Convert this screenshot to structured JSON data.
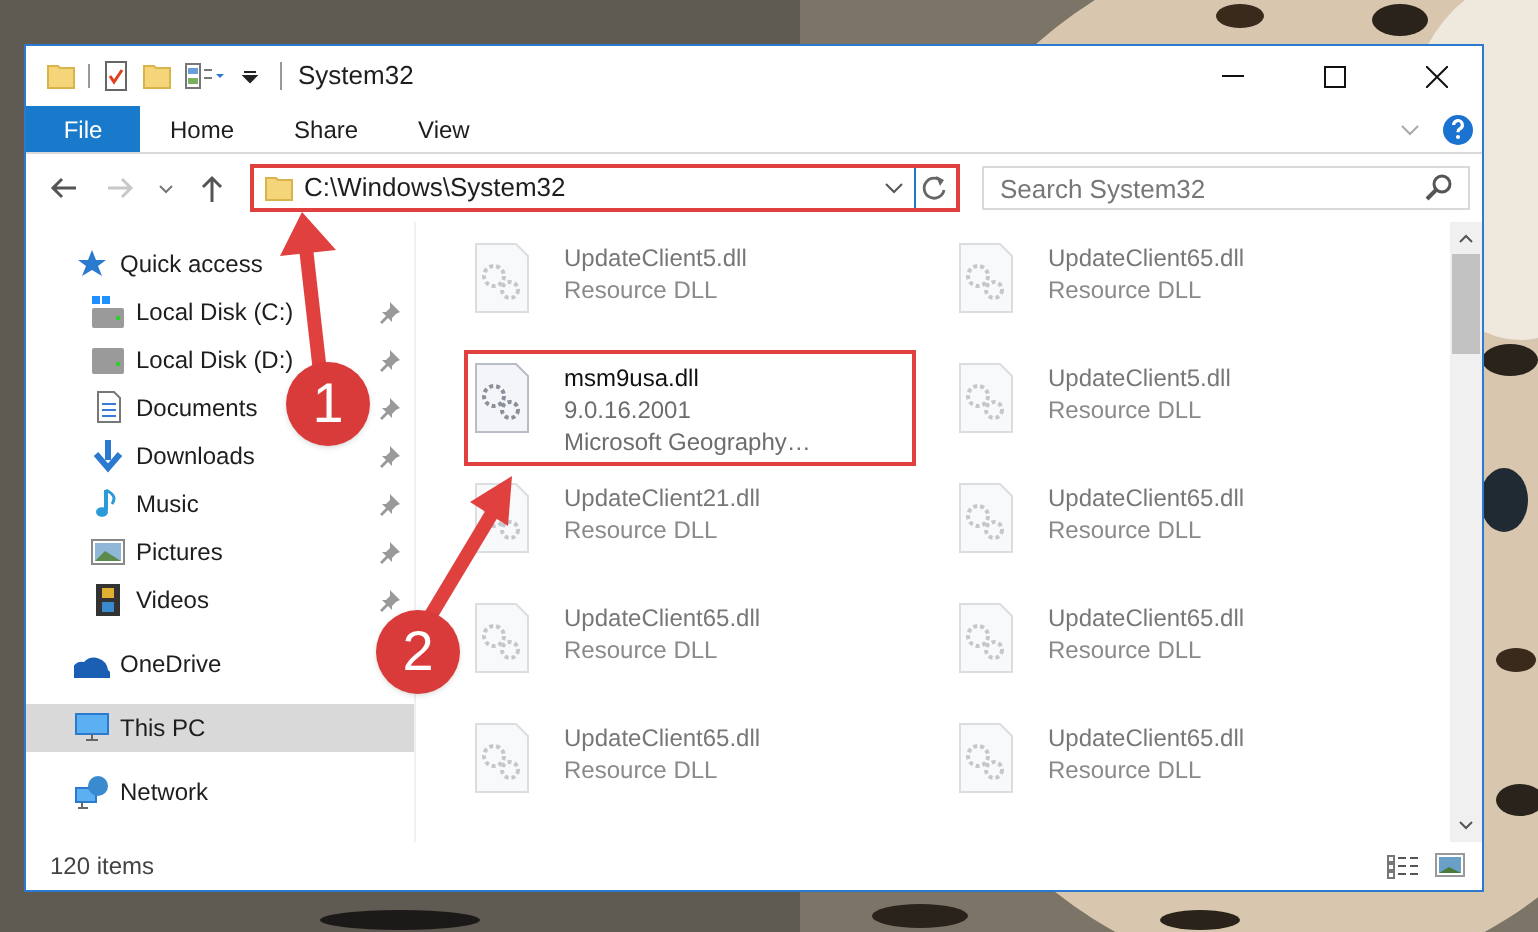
{
  "window": {
    "title": "System32"
  },
  "ribbon": {
    "tabs": [
      {
        "label": "File",
        "kind": "file"
      },
      {
        "label": "Home",
        "kind": "tab"
      },
      {
        "label": "Share",
        "kind": "tab"
      },
      {
        "label": "View",
        "kind": "tab"
      }
    ]
  },
  "navigation": {
    "back": {
      "disabled": false
    },
    "forward": {
      "disabled": true
    }
  },
  "address_bar": {
    "value": "C:\\Windows\\System32",
    "highlighted": true
  },
  "search": {
    "placeholder": "Search System32"
  },
  "sidebar": {
    "items": [
      {
        "label": "Quick access",
        "kind": "star",
        "selected": false,
        "children": [
          {
            "label": "Local Disk (C:)",
            "kind": "system-drive",
            "pinned": true
          },
          {
            "label": "Local Disk (D:)",
            "kind": "drive",
            "pinned": true
          },
          {
            "label": "Documents",
            "kind": "documents",
            "pinned": true
          },
          {
            "label": "Downloads",
            "kind": "downloads",
            "pinned": true
          },
          {
            "label": "Music",
            "kind": "music",
            "pinned": true
          },
          {
            "label": "Pictures",
            "kind": "pictures",
            "pinned": true
          },
          {
            "label": "Videos",
            "kind": "videos",
            "pinned": true
          }
        ]
      },
      {
        "label": "OneDrive",
        "kind": "cloud",
        "selected": false
      },
      {
        "label": "This PC",
        "kind": "computer",
        "selected": true
      },
      {
        "label": "Network",
        "kind": "network",
        "selected": false
      }
    ]
  },
  "files": [
    {
      "lines": [
        "UpdateClient5.dll",
        "Resource DLL"
      ],
      "blurred": true,
      "highlighted": false
    },
    {
      "lines": [
        "UpdateClient65.dll",
        "Resource DLL"
      ],
      "blurred": true,
      "highlighted": false
    },
    {
      "lines": [
        "msm9usa.dll",
        "9.0.16.2001",
        "Microsoft Geography…"
      ],
      "blurred": false,
      "highlighted": true
    },
    {
      "lines": [
        "UpdateClient5.dll",
        "Resource DLL"
      ],
      "blurred": true,
      "highlighted": false
    },
    {
      "lines": [
        "UpdateClient21.dll",
        "Resource DLL"
      ],
      "blurred": true,
      "highlighted": false
    },
    {
      "lines": [
        "UpdateClient65.dll",
        "Resource DLL"
      ],
      "blurred": true,
      "highlighted": false
    },
    {
      "lines": [
        "UpdateClient65.dll",
        "Resource DLL"
      ],
      "blurred": true,
      "highlighted": false
    },
    {
      "lines": [
        "UpdateClient65.dll",
        "Resource DLL"
      ],
      "blurred": true,
      "highlighted": false
    },
    {
      "lines": [
        "UpdateClient65.dll",
        "Resource DLL"
      ],
      "blurred": true,
      "highlighted": false
    },
    {
      "lines": [
        "UpdateClient65.dll",
        "Resource DLL"
      ],
      "blurred": true,
      "highlighted": false
    }
  ],
  "status_bar": {
    "text": "120 items"
  },
  "callouts": [
    {
      "label": "1"
    },
    {
      "label": "2"
    }
  ]
}
